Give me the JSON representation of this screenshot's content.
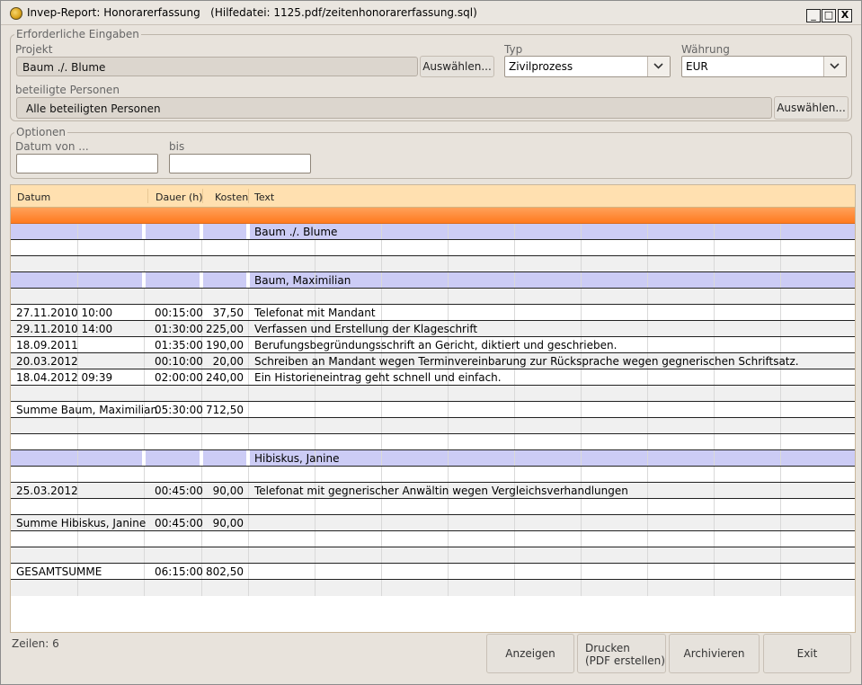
{
  "window": {
    "title": "Invep-Report: Honorarerfassung",
    "help_file": "(Hilfedatei: 1125.pdf/zeitenhonorarerfassung.sql)",
    "min_label": "_",
    "max_label": "□",
    "close_label": "X"
  },
  "required": {
    "legend": "Erforderliche Eingaben",
    "projekt_label": "Projekt",
    "projekt_value": "Baum ./. Blume",
    "projekt_button": "Auswählen...",
    "typ_label": "Typ",
    "typ_value": "Zivilprozess",
    "waehrung_label": "Währung",
    "waehrung_value": "EUR",
    "personen_label": "beteiligte Personen",
    "personen_value": "Alle beteiligten Personen",
    "personen_button": "Auswählen..."
  },
  "options": {
    "legend": "Optionen",
    "datum_von_label": "Datum von ...",
    "bis_label": "bis",
    "datum_von_value": "",
    "bis_value": ""
  },
  "table": {
    "columns": {
      "datum": "Datum",
      "dauer": "Dauer (h)",
      "kosten": "Kosten",
      "text": "Text"
    },
    "rows": [
      {
        "style": "blue",
        "datum": "",
        "dauer": "",
        "kosten": "",
        "text": "Baum ./. Blume"
      },
      {
        "style": "white",
        "datum": "",
        "dauer": "",
        "kosten": "",
        "text": ""
      },
      {
        "style": "gray",
        "datum": "",
        "dauer": "",
        "kosten": "",
        "text": ""
      },
      {
        "style": "blue",
        "datum": "",
        "dauer": "",
        "kosten": "",
        "text": "Baum, Maximilian"
      },
      {
        "style": "gray",
        "datum": "",
        "dauer": "",
        "kosten": "",
        "text": ""
      },
      {
        "style": "white",
        "datum": "27.11.2010 10:00",
        "dauer": "00:15:00",
        "kosten": "37,50",
        "text": "Telefonat mit Mandant"
      },
      {
        "style": "gray",
        "datum": "29.11.2010 14:00",
        "dauer": "01:30:00",
        "kosten": "225,00",
        "text": "Verfassen und Erstellung der Klageschrift"
      },
      {
        "style": "white",
        "datum": "18.09.2011",
        "dauer": "01:35:00",
        "kosten": "190,00",
        "text": "Berufungsbegründungsschrift an Gericht, diktiert und geschrieben."
      },
      {
        "style": "gray",
        "datum": "20.03.2012",
        "dauer": "00:10:00",
        "kosten": "20,00",
        "text": "Schreiben an Mandant wegen Terminvereinbarung zur Rücksprache wegen gegnerischen Schriftsatz."
      },
      {
        "style": "white",
        "datum": "18.04.2012 09:39",
        "dauer": "02:00:00",
        "kosten": "240,00",
        "text": "Ein Historieneintrag geht schnell und einfach."
      },
      {
        "style": "gray",
        "datum": "",
        "dauer": "",
        "kosten": "",
        "text": ""
      },
      {
        "style": "white",
        "datum": "Summe Baum, Maximilian",
        "dauer": "05:30:00",
        "kosten": "712,50",
        "text": ""
      },
      {
        "style": "gray",
        "datum": "",
        "dauer": "",
        "kosten": "",
        "text": ""
      },
      {
        "style": "white",
        "datum": "",
        "dauer": "",
        "kosten": "",
        "text": ""
      },
      {
        "style": "blue",
        "datum": "",
        "dauer": "",
        "kosten": "",
        "text": "Hibiskus, Janine"
      },
      {
        "style": "white",
        "datum": "",
        "dauer": "",
        "kosten": "",
        "text": ""
      },
      {
        "style": "gray",
        "datum": "25.03.2012",
        "dauer": "00:45:00",
        "kosten": "90,00",
        "text": "Telefonat mit gegnerischer Anwältin wegen Vergleichsverhandlungen"
      },
      {
        "style": "white",
        "datum": "",
        "dauer": "",
        "kosten": "",
        "text": ""
      },
      {
        "style": "gray",
        "datum": "Summe Hibiskus, Janine",
        "dauer": "00:45:00",
        "kosten": "90,00",
        "text": ""
      },
      {
        "style": "white",
        "datum": "",
        "dauer": "",
        "kosten": "",
        "text": ""
      },
      {
        "style": "gray",
        "datum": "",
        "dauer": "",
        "kosten": "",
        "text": ""
      },
      {
        "style": "white",
        "datum": "GESAMTSUMME",
        "dauer": "06:15:00",
        "kosten": "802,50",
        "text": ""
      },
      {
        "style": "gray",
        "datum": "",
        "dauer": "",
        "kosten": "",
        "text": ""
      }
    ]
  },
  "footer": {
    "rows_count": "Zeilen: 6",
    "anzeigen": "Anzeigen",
    "drucken": "Drucken\n(PDF erstellen)",
    "archivieren": "Archivieren",
    "exit": "Exit"
  },
  "colors": {
    "header_bg": "#ffe0b0",
    "accent_orange": "#ff8a30",
    "group_row_blue": "#ccccf5"
  }
}
